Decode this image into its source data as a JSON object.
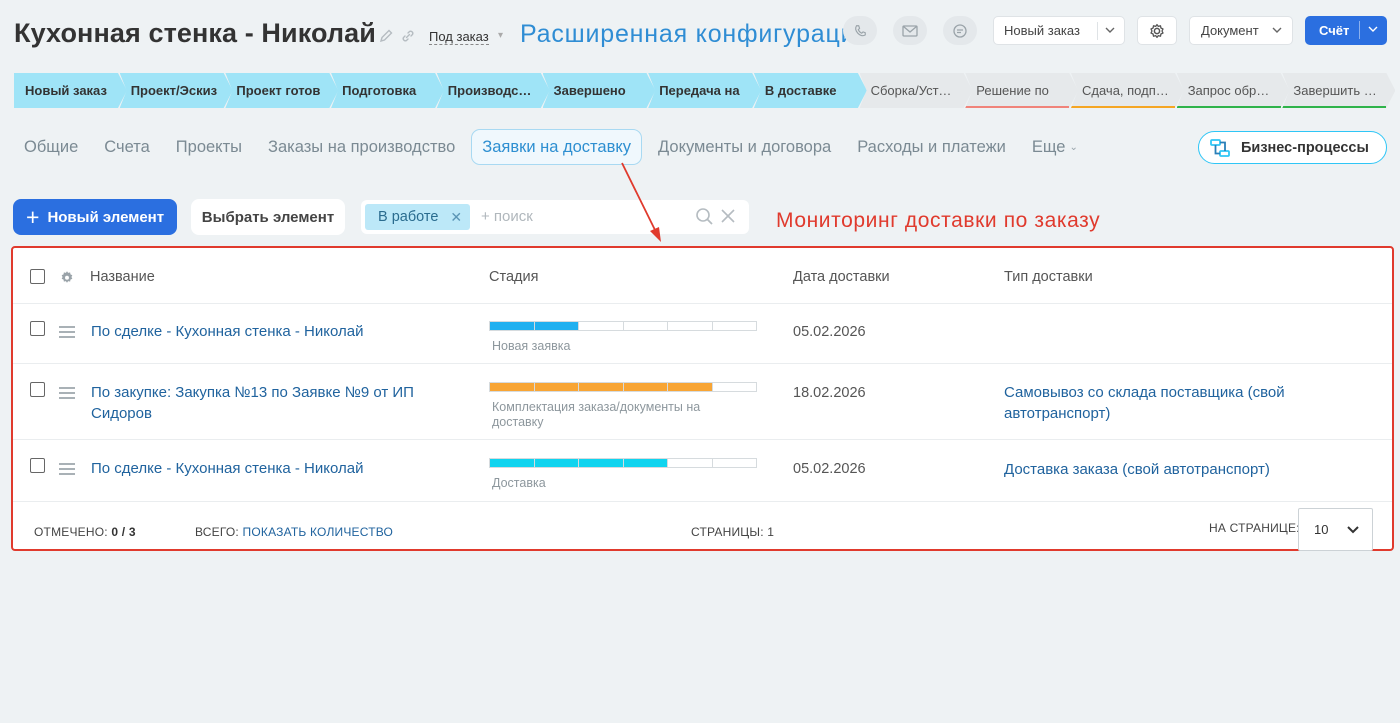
{
  "header": {
    "title": "Кухонная стенка - Николай",
    "order_type": "Под заказ",
    "config_title": "Расширенная конфигурация",
    "new_order_label": "Новый заказ",
    "document_label": "Документ",
    "invoice_label": "Счёт"
  },
  "stages": [
    {
      "label": "Новый заказ",
      "state": "active"
    },
    {
      "label": "Проект/Эскиз",
      "state": "active"
    },
    {
      "label": "Проект готов",
      "state": "active"
    },
    {
      "label": "Подготовка",
      "state": "active"
    },
    {
      "label": "Производство",
      "state": "active"
    },
    {
      "label": "Завершено",
      "state": "active"
    },
    {
      "label": "Передача на",
      "state": "active"
    },
    {
      "label": "В доставке",
      "state": "active"
    },
    {
      "label": "Сборка/Установка",
      "state": "inactive",
      "line": ""
    },
    {
      "label": "Решение по",
      "state": "inactive",
      "line": "#f0837a"
    },
    {
      "label": "Сдача, подписание",
      "state": "inactive",
      "line": "#f5a623"
    },
    {
      "label": "Запрос обратной",
      "state": "inactive",
      "line": "#2fb34a"
    },
    {
      "label": "Завершить сделку",
      "state": "inactive",
      "line": "#2fb34a"
    }
  ],
  "tabs": [
    {
      "label": "Общие"
    },
    {
      "label": "Счета"
    },
    {
      "label": "Проекты"
    },
    {
      "label": "Заказы на производство"
    },
    {
      "label": "Заявки на доставку",
      "active": true
    },
    {
      "label": "Документы и договора"
    },
    {
      "label": "Расходы и платежи"
    },
    {
      "label": "Еще"
    }
  ],
  "bp_button": "Бизнес-процессы",
  "toolbar": {
    "new_element": "Новый элемент",
    "select_element": "Выбрать элемент",
    "filter_chip": "В работе",
    "search_placeholder": "+ поиск"
  },
  "annotation": "Мониторинг доставки по заказу",
  "grid": {
    "columns": {
      "name": "Название",
      "stage": "Стадия",
      "date": "Дата доставки",
      "type": "Тип доставки"
    },
    "rows": [
      {
        "name": "По сделке - Кухонная стенка - Николай",
        "stage_label": "Новая заявка",
        "stage_fill": 0.25,
        "stage_color": "#1fb0f0",
        "date": "05.02.2026",
        "delivery_type": ""
      },
      {
        "name": "По закупке: Закупка №13 по Заявке №9 от ИП Сидоров",
        "stage_label": "Комплектация заказа/документы на доставку",
        "stage_fill": 0.75,
        "stage_color": "#f8a535",
        "date": "18.02.2026",
        "delivery_type": "Самовывоз со склада поставщика (свой автотранспорт)"
      },
      {
        "name": "По сделке - Кухонная стенка - Николай",
        "stage_label": "Доставка",
        "stage_fill": 0.667,
        "stage_color": "#10d4ef",
        "date": "05.02.2026",
        "delivery_type": "Доставка заказа (свой автотранспорт)"
      }
    ],
    "footer": {
      "selected_label": "Отмечено:",
      "selected_value": "0 / 3",
      "total_label": "Всего:",
      "total_link": "Показать количество",
      "pages_label": "Страницы:",
      "pages_value": "1",
      "per_page_label": "На странице:",
      "per_page_value": "10"
    }
  }
}
